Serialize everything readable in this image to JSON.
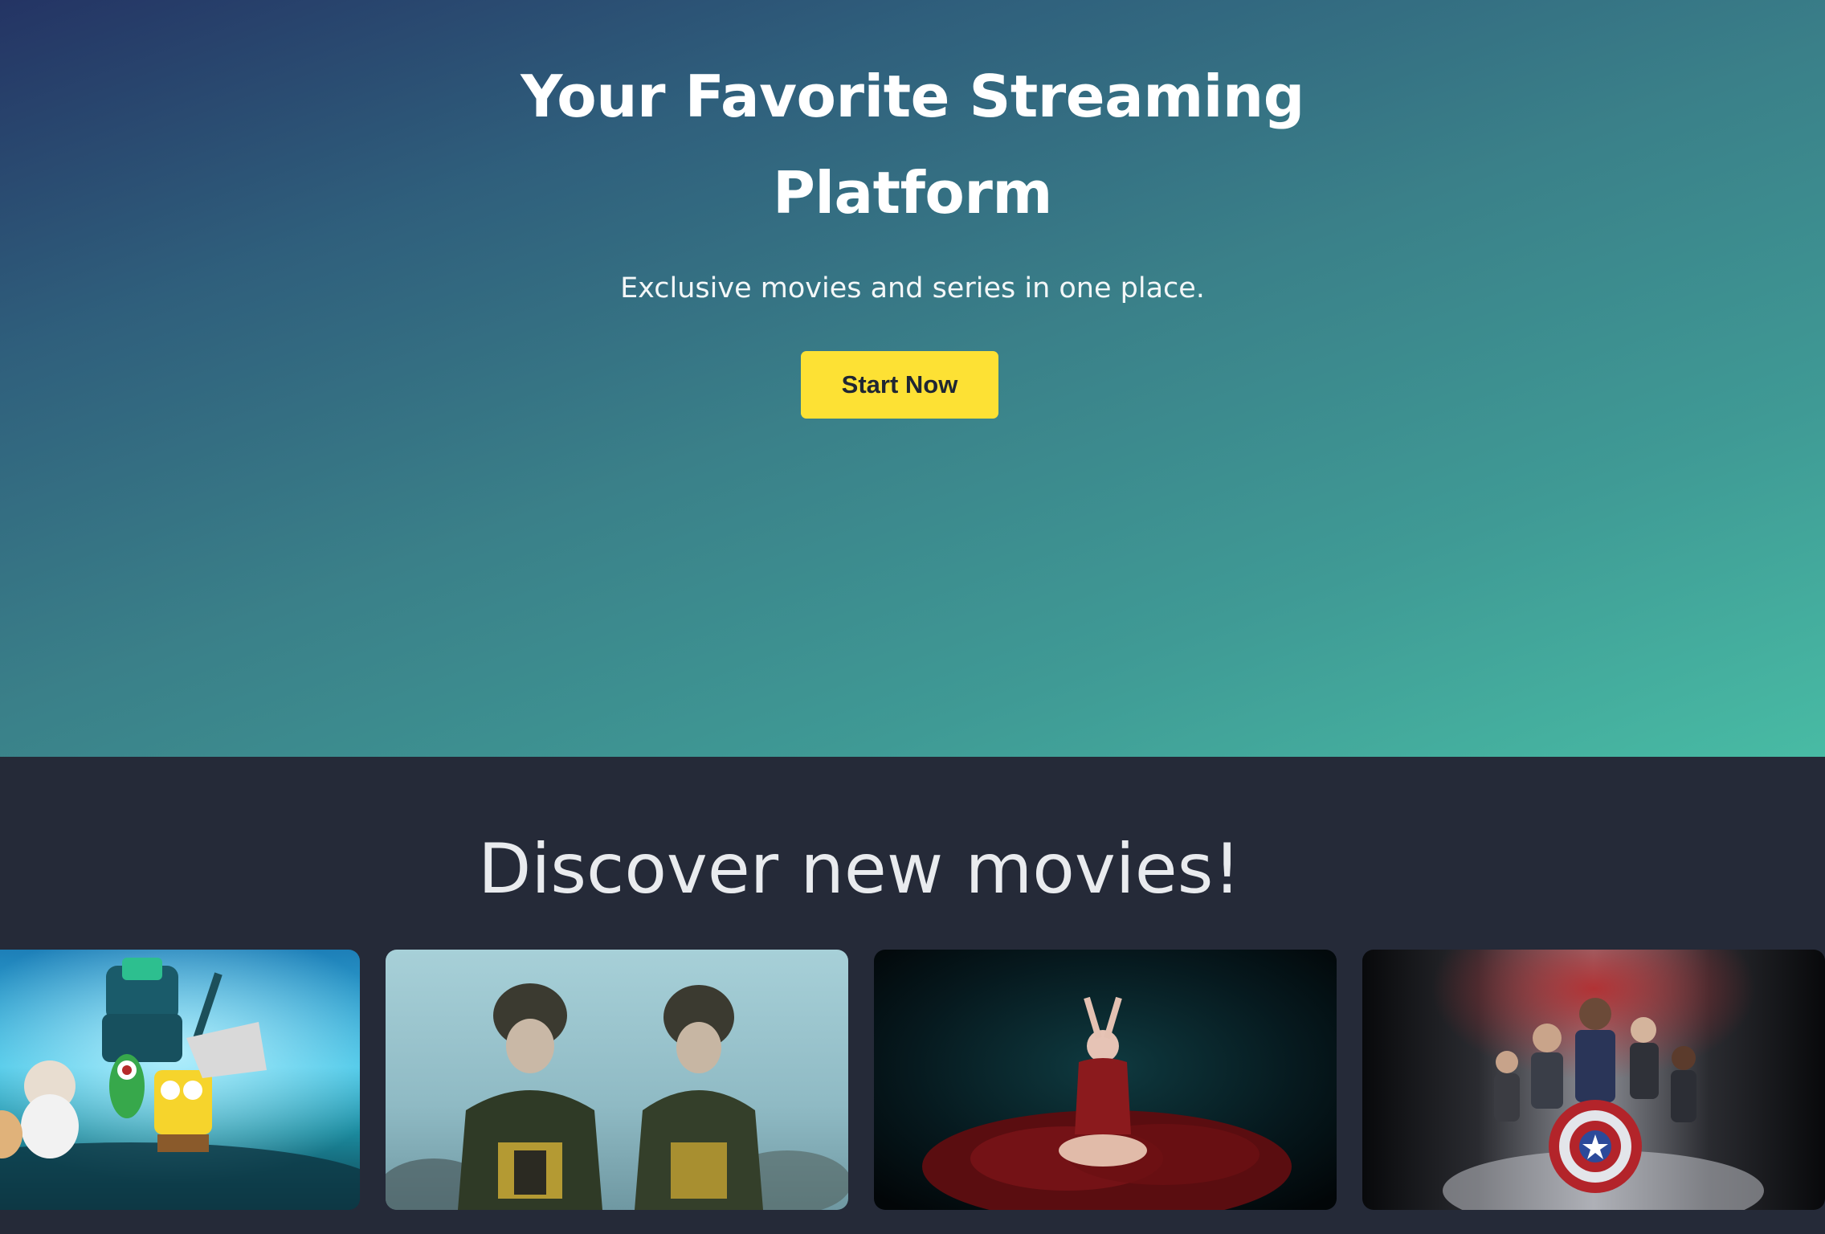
{
  "hero": {
    "title": "Your Favorite Streaming Platform",
    "subtitle": "Exclusive movies and series in one place.",
    "cta_label": "Start Now"
  },
  "discover": {
    "title": "Discover new movies!",
    "cards": [
      {
        "name": "animated-undersea-adventure"
      },
      {
        "name": "soldiers-in-snow"
      },
      {
        "name": "woman-in-red-dress"
      },
      {
        "name": "superhero-team"
      }
    ]
  },
  "colors": {
    "hero_gradient_start": "#243464",
    "hero_gradient_end": "#48bba4",
    "section_bg": "#252a38",
    "cta_bg": "#fde134",
    "cta_text": "#1f2633"
  }
}
